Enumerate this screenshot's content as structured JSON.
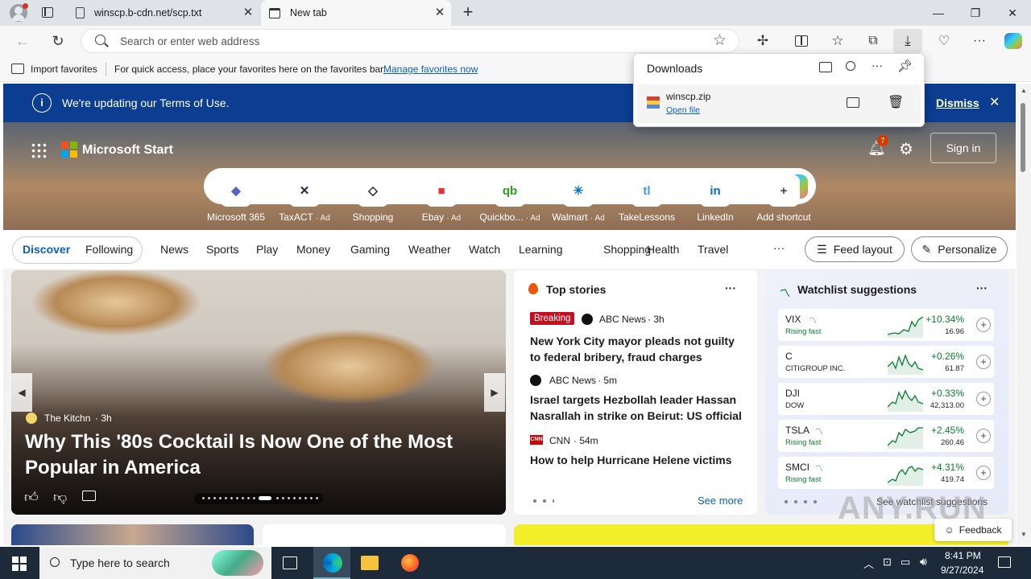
{
  "browser": {
    "tabs": [
      {
        "label": "winscp.b-cdn.net/scp.txt"
      },
      {
        "label": "New tab"
      }
    ],
    "address_placeholder": "Search or enter web address",
    "favbar": {
      "import_label": "Import favorites",
      "hint": "For quick access, place your favorites here on the favorites bar.",
      "manage_link": "Manage favorites now"
    }
  },
  "downloads": {
    "title": "Downloads",
    "file_name": "winscp.zip",
    "open_link": "Open file"
  },
  "banner": {
    "text": "We're updating our Terms of Use.",
    "dismiss": "Dismiss"
  },
  "header": {
    "brand": "Microsoft Start",
    "notif_count": "7",
    "signin": "Sign in"
  },
  "shortcuts": [
    {
      "label": "Microsoft 365",
      "ad": "",
      "color": "#5b5fc7",
      "glyph": "◆"
    },
    {
      "label": "TaxACT",
      "ad": "· Ad",
      "color": "#1f2a44",
      "glyph": "✕"
    },
    {
      "label": "Shopping",
      "ad": "",
      "color": "#1b1b1b",
      "glyph": "◇"
    },
    {
      "label": "Ebay",
      "ad": "· Ad",
      "color": "#e53238",
      "glyph": "■"
    },
    {
      "label": "Quickbo...",
      "ad": "· Ad",
      "color": "#2ca01c",
      "glyph": "qb"
    },
    {
      "label": "Walmart",
      "ad": "· Ad",
      "color": "#0071ce",
      "glyph": "✳"
    },
    {
      "label": "TakeLessons",
      "ad": "",
      "color": "#3aa0e0",
      "glyph": "tl"
    },
    {
      "label": "LinkedIn",
      "ad": "",
      "color": "#0a66c2",
      "glyph": "in"
    },
    {
      "label": "Add shortcut",
      "ad": "",
      "color": "#444444",
      "glyph": "+"
    }
  ],
  "nav": {
    "discover": "Discover",
    "following": "Following",
    "items": [
      "News",
      "Sports",
      "Play",
      "Money",
      "Gaming",
      "Weather",
      "Watch",
      "Learning",
      "Shopping",
      "Health",
      "Travel"
    ],
    "more": "···",
    "feed_layout": "Feed layout",
    "personalize": "Personalize"
  },
  "hero_story": {
    "source": "The Kitchn",
    "age": "· 3h",
    "title": "Why This '80s Cocktail Is Now One of the Most Popular in America"
  },
  "top_stories": {
    "title": "Top stories",
    "items": [
      {
        "badge": "Breaking",
        "source": "ABC News",
        "age": "· 3h",
        "headline": "New York City mayor pleads not guilty to federal bribery, fraud charges"
      },
      {
        "badge": "",
        "source": "ABC News",
        "age": "· 5m",
        "headline": "Israel targets Hezbollah leader Hassan Nasrallah in strike on Beirut: US official"
      },
      {
        "badge": "",
        "source": "CNN",
        "age": "· 54m",
        "headline": "How to help Hurricane Helene victims"
      }
    ],
    "see_more": "See more"
  },
  "watchlist": {
    "title": "Watchlist suggestions",
    "rows": [
      {
        "symbol": "VIX",
        "sub": "Rising fast",
        "change": "+10.34%",
        "price": "16.96",
        "rising": true
      },
      {
        "symbol": "C",
        "sub": "CITIGROUP INC.",
        "change": "+0.26%",
        "price": "61.87",
        "rising": false
      },
      {
        "symbol": "DJI",
        "sub": "DOW",
        "change": "+0.33%",
        "price": "42,313.00",
        "rising": false
      },
      {
        "symbol": "TSLA",
        "sub": "Rising fast",
        "change": "+2.45%",
        "price": "260.46",
        "rising": true
      },
      {
        "symbol": "SMCI",
        "sub": "Rising fast",
        "change": "+4.31%",
        "price": "419.74",
        "rising": true
      }
    ],
    "see_link": "See watchlist suggestions"
  },
  "feedback": "Feedback",
  "watermark": "ANY.RUN",
  "taskbar": {
    "search_placeholder": "Type here to search",
    "time": "8:41 PM",
    "date": "9/27/2024"
  }
}
